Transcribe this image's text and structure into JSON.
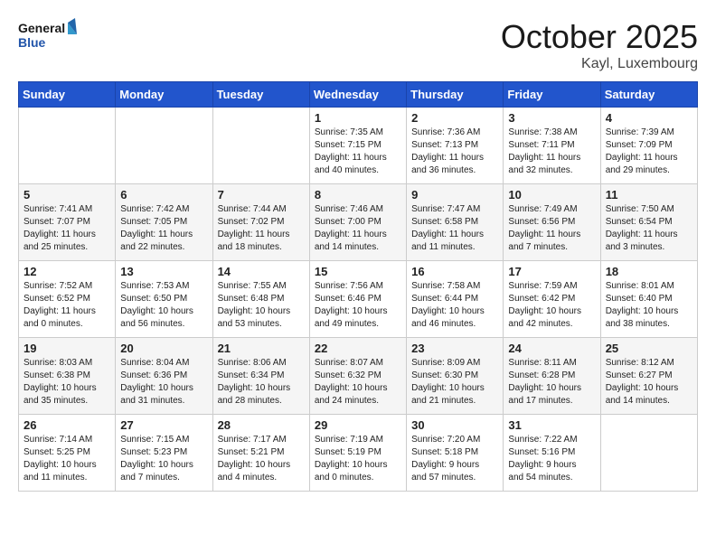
{
  "header": {
    "logo_line1": "General",
    "logo_line2": "Blue",
    "month": "October 2025",
    "location": "Kayl, Luxembourg"
  },
  "weekdays": [
    "Sunday",
    "Monday",
    "Tuesday",
    "Wednesday",
    "Thursday",
    "Friday",
    "Saturday"
  ],
  "weeks": [
    [
      {
        "day": "",
        "info": ""
      },
      {
        "day": "",
        "info": ""
      },
      {
        "day": "",
        "info": ""
      },
      {
        "day": "1",
        "info": "Sunrise: 7:35 AM\nSunset: 7:15 PM\nDaylight: 11 hours\nand 40 minutes."
      },
      {
        "day": "2",
        "info": "Sunrise: 7:36 AM\nSunset: 7:13 PM\nDaylight: 11 hours\nand 36 minutes."
      },
      {
        "day": "3",
        "info": "Sunrise: 7:38 AM\nSunset: 7:11 PM\nDaylight: 11 hours\nand 32 minutes."
      },
      {
        "day": "4",
        "info": "Sunrise: 7:39 AM\nSunset: 7:09 PM\nDaylight: 11 hours\nand 29 minutes."
      }
    ],
    [
      {
        "day": "5",
        "info": "Sunrise: 7:41 AM\nSunset: 7:07 PM\nDaylight: 11 hours\nand 25 minutes."
      },
      {
        "day": "6",
        "info": "Sunrise: 7:42 AM\nSunset: 7:05 PM\nDaylight: 11 hours\nand 22 minutes."
      },
      {
        "day": "7",
        "info": "Sunrise: 7:44 AM\nSunset: 7:02 PM\nDaylight: 11 hours\nand 18 minutes."
      },
      {
        "day": "8",
        "info": "Sunrise: 7:46 AM\nSunset: 7:00 PM\nDaylight: 11 hours\nand 14 minutes."
      },
      {
        "day": "9",
        "info": "Sunrise: 7:47 AM\nSunset: 6:58 PM\nDaylight: 11 hours\nand 11 minutes."
      },
      {
        "day": "10",
        "info": "Sunrise: 7:49 AM\nSunset: 6:56 PM\nDaylight: 11 hours\nand 7 minutes."
      },
      {
        "day": "11",
        "info": "Sunrise: 7:50 AM\nSunset: 6:54 PM\nDaylight: 11 hours\nand 3 minutes."
      }
    ],
    [
      {
        "day": "12",
        "info": "Sunrise: 7:52 AM\nSunset: 6:52 PM\nDaylight: 11 hours\nand 0 minutes."
      },
      {
        "day": "13",
        "info": "Sunrise: 7:53 AM\nSunset: 6:50 PM\nDaylight: 10 hours\nand 56 minutes."
      },
      {
        "day": "14",
        "info": "Sunrise: 7:55 AM\nSunset: 6:48 PM\nDaylight: 10 hours\nand 53 minutes."
      },
      {
        "day": "15",
        "info": "Sunrise: 7:56 AM\nSunset: 6:46 PM\nDaylight: 10 hours\nand 49 minutes."
      },
      {
        "day": "16",
        "info": "Sunrise: 7:58 AM\nSunset: 6:44 PM\nDaylight: 10 hours\nand 46 minutes."
      },
      {
        "day": "17",
        "info": "Sunrise: 7:59 AM\nSunset: 6:42 PM\nDaylight: 10 hours\nand 42 minutes."
      },
      {
        "day": "18",
        "info": "Sunrise: 8:01 AM\nSunset: 6:40 PM\nDaylight: 10 hours\nand 38 minutes."
      }
    ],
    [
      {
        "day": "19",
        "info": "Sunrise: 8:03 AM\nSunset: 6:38 PM\nDaylight: 10 hours\nand 35 minutes."
      },
      {
        "day": "20",
        "info": "Sunrise: 8:04 AM\nSunset: 6:36 PM\nDaylight: 10 hours\nand 31 minutes."
      },
      {
        "day": "21",
        "info": "Sunrise: 8:06 AM\nSunset: 6:34 PM\nDaylight: 10 hours\nand 28 minutes."
      },
      {
        "day": "22",
        "info": "Sunrise: 8:07 AM\nSunset: 6:32 PM\nDaylight: 10 hours\nand 24 minutes."
      },
      {
        "day": "23",
        "info": "Sunrise: 8:09 AM\nSunset: 6:30 PM\nDaylight: 10 hours\nand 21 minutes."
      },
      {
        "day": "24",
        "info": "Sunrise: 8:11 AM\nSunset: 6:28 PM\nDaylight: 10 hours\nand 17 minutes."
      },
      {
        "day": "25",
        "info": "Sunrise: 8:12 AM\nSunset: 6:27 PM\nDaylight: 10 hours\nand 14 minutes."
      }
    ],
    [
      {
        "day": "26",
        "info": "Sunrise: 7:14 AM\nSunset: 5:25 PM\nDaylight: 10 hours\nand 11 minutes."
      },
      {
        "day": "27",
        "info": "Sunrise: 7:15 AM\nSunset: 5:23 PM\nDaylight: 10 hours\nand 7 minutes."
      },
      {
        "day": "28",
        "info": "Sunrise: 7:17 AM\nSunset: 5:21 PM\nDaylight: 10 hours\nand 4 minutes."
      },
      {
        "day": "29",
        "info": "Sunrise: 7:19 AM\nSunset: 5:19 PM\nDaylight: 10 hours\nand 0 minutes."
      },
      {
        "day": "30",
        "info": "Sunrise: 7:20 AM\nSunset: 5:18 PM\nDaylight: 9 hours\nand 57 minutes."
      },
      {
        "day": "31",
        "info": "Sunrise: 7:22 AM\nSunset: 5:16 PM\nDaylight: 9 hours\nand 54 minutes."
      },
      {
        "day": "",
        "info": ""
      }
    ]
  ]
}
